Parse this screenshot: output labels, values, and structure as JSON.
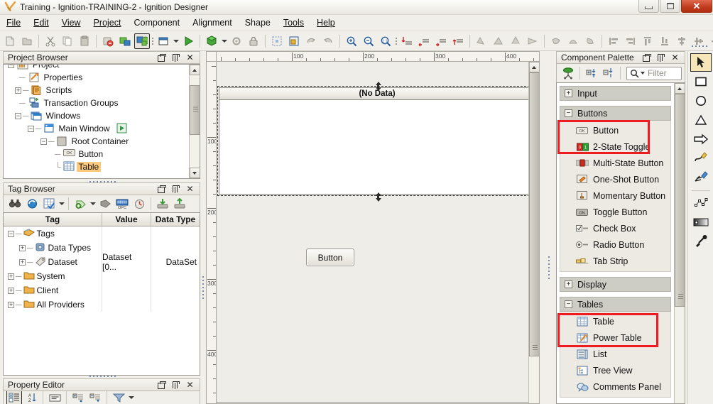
{
  "window": {
    "title": "Training - Ignition-TRAINING-2 - Ignition Designer",
    "app_icon": "ignition-logo-icon",
    "controls": {
      "minimize": "minimize-icon",
      "maximize": "maximize-icon",
      "close": "✕"
    }
  },
  "menubar": {
    "items": [
      {
        "label": "File",
        "mnemonic": "F"
      },
      {
        "label": "Edit",
        "mnemonic": "E"
      },
      {
        "label": "View",
        "mnemonic": "V"
      },
      {
        "label": "Project",
        "mnemonic": "P"
      },
      {
        "label": "Component",
        "mnemonic": "C"
      },
      {
        "label": "Alignment",
        "mnemonic": "A"
      },
      {
        "label": "Shape",
        "mnemonic": "S"
      },
      {
        "label": "Tools",
        "mnemonic": "T"
      },
      {
        "label": "Help",
        "mnemonic": "H"
      }
    ]
  },
  "toolbar": {
    "groups": [
      {
        "buttons": [
          {
            "name": "new-icon",
            "disabled": true
          },
          {
            "name": "open-icon",
            "disabled": true
          }
        ]
      },
      {
        "buttons": [
          {
            "name": "cut-icon",
            "disabled": true
          },
          {
            "name": "copy-icon",
            "disabled": true
          },
          {
            "name": "paste-icon",
            "disabled": true
          }
        ]
      },
      {
        "buttons": [
          {
            "name": "save-disabled-icon",
            "disabled": true
          },
          {
            "name": "publish-icon",
            "disabled": false
          },
          {
            "name": "update-project-icon",
            "selected": true
          }
        ]
      },
      {
        "buttons": [
          {
            "name": "new-window-icon",
            "disabled": false
          },
          {
            "name": "window-dropdown-arrow",
            "type": "arrow"
          },
          {
            "name": "preview-mode-icon",
            "disabled": false
          }
        ]
      },
      {
        "buttons": [
          {
            "name": "new-template-icon",
            "disabled": false
          },
          {
            "name": "template-dropdown-arrow",
            "type": "arrow"
          },
          {
            "name": "settings-icon",
            "disabled": true
          },
          {
            "name": "lock-icon",
            "disabled": true
          }
        ]
      },
      {
        "buttons": [
          {
            "name": "select-all-icon",
            "disabled": true
          },
          {
            "name": "group-selection-icon",
            "disabled": false
          },
          {
            "name": "rotate-cw-icon",
            "disabled": true
          },
          {
            "name": "rotate-ccw-icon",
            "disabled": true
          }
        ]
      },
      {
        "buttons": [
          {
            "name": "zoom-in-icon",
            "disabled": false
          },
          {
            "name": "zoom-out-icon",
            "disabled": false
          },
          {
            "name": "zoom-reset-icon",
            "disabled": false
          }
        ]
      },
      {
        "buttons": [
          {
            "name": "bring-to-front-icon",
            "disabled": false
          },
          {
            "name": "send-backward-icon",
            "disabled": false
          },
          {
            "name": "bring-forward-icon",
            "disabled": false
          },
          {
            "name": "send-to-back-icon",
            "disabled": false
          }
        ]
      },
      {
        "buttons": [
          {
            "name": "shape-union-icon",
            "disabled": true
          },
          {
            "name": "shape-subtract-icon",
            "disabled": true
          },
          {
            "name": "shape-intersect-icon",
            "disabled": true
          },
          {
            "name": "shape-xor-icon",
            "disabled": true
          }
        ]
      },
      {
        "buttons": [
          {
            "name": "shape-combine-a-icon",
            "disabled": true
          },
          {
            "name": "shape-combine-b-icon",
            "disabled": true
          },
          {
            "name": "shape-combine-c-icon",
            "disabled": true
          }
        ]
      },
      {
        "buttons": [
          {
            "name": "align-left-icon",
            "disabled": true
          },
          {
            "name": "align-right-icon",
            "disabled": true
          },
          {
            "name": "align-top-icon",
            "disabled": true
          },
          {
            "name": "align-bottom-icon",
            "disabled": true
          },
          {
            "name": "align-center-h-icon",
            "disabled": true
          },
          {
            "name": "align-center-v-icon",
            "disabled": true
          },
          {
            "name": "distribute-h-icon",
            "disabled": true
          },
          {
            "name": "distribute-h-arrow",
            "type": "arrow"
          },
          {
            "name": "distribute-v-icon",
            "disabled": true
          },
          {
            "name": "distribute-v-arrow",
            "type": "arrow"
          },
          {
            "name": "same-width-icon",
            "disabled": false
          },
          {
            "name": "same-height-icon",
            "disabled": false
          }
        ]
      }
    ]
  },
  "project_browser": {
    "title": "Project Browser",
    "tree": [
      {
        "label": "Project",
        "icon": "project-icon",
        "depth": 0,
        "expander": "-",
        "partial": true
      },
      {
        "label": "Properties",
        "icon": "properties-icon",
        "depth": 1,
        "expander": ""
      },
      {
        "label": "Scripts",
        "icon": "scripts-icon",
        "depth": 1,
        "expander": "+"
      },
      {
        "label": "Transaction Groups",
        "icon": "transaction-groups-icon",
        "depth": 1,
        "expander": ""
      },
      {
        "label": "Windows",
        "icon": "windows-folder-icon",
        "depth": 1,
        "expander": "-"
      },
      {
        "label": "Main Window",
        "icon": "window-icon",
        "depth": 2,
        "expander": "-",
        "badge": "open-window-icon"
      },
      {
        "label": "Root Container",
        "icon": "container-icon",
        "depth": 3,
        "expander": "-"
      },
      {
        "label": "Button",
        "icon": "button-component-icon",
        "depth": 4,
        "expander": ""
      },
      {
        "label": "Table",
        "icon": "table-component-icon",
        "depth": 4,
        "expander": "",
        "selected": true
      }
    ]
  },
  "tag_browser": {
    "title": "Tag Browser",
    "toolbar": [
      "binoculars-icon",
      "refresh-tags-icon",
      "tag-editor-icon",
      "tag-dropdown-arrow",
      "new-tag-icon",
      "new-tag-dropdown-arrow",
      "tag-type-icon",
      "opc-browser-icon",
      "realtime-icon",
      "import-tags-icon",
      "export-tags-icon"
    ],
    "columns": [
      "Tag",
      "Value",
      "Data Type"
    ],
    "rows": [
      {
        "tag": "Tags",
        "value": "",
        "datatype": "",
        "depth": 0,
        "expander": "-",
        "icon": "tags-root-icon",
        "selected": true,
        "style": "italic-bold"
      },
      {
        "tag": "Data Types",
        "value": "",
        "datatype": "",
        "depth": 1,
        "expander": "+",
        "icon": "data-types-icon"
      },
      {
        "tag": "Dataset",
        "value": "Dataset [0...",
        "datatype": "DataSet",
        "depth": 1,
        "expander": "+",
        "icon": "dataset-tag-icon"
      },
      {
        "tag": "System",
        "value": "",
        "datatype": "",
        "depth": 0,
        "expander": "+",
        "icon": "folder-icon"
      },
      {
        "tag": "Client",
        "value": "",
        "datatype": "",
        "depth": 0,
        "expander": "+",
        "icon": "folder-icon"
      },
      {
        "tag": "All Providers",
        "value": "",
        "datatype": "",
        "depth": 0,
        "expander": "+",
        "icon": "folder-icon"
      }
    ]
  },
  "property_editor": {
    "title": "Property Editor",
    "toolbar": [
      "property-categories-icon",
      "sort-az-icon",
      "description-icon",
      "expand-all-icon",
      "collapse-all-icon",
      "filter-icon",
      "filter-dropdown-arrow"
    ]
  },
  "designer": {
    "ruler_h_labels": [
      "100",
      "200",
      "300",
      "400"
    ],
    "ruler_v_labels": [
      "100",
      "200",
      "300",
      "400"
    ],
    "table_component": {
      "header_text": "(No Data)",
      "name": "table-component",
      "selected": true
    },
    "button_component": {
      "label": "Button",
      "name": "button-component"
    }
  },
  "component_palette": {
    "title": "Component Palette",
    "toolbar": [
      "palette-root-icon",
      "expand-all-groups-icon",
      "collapse-all-groups-icon"
    ],
    "filter": {
      "placeholder": "Filter",
      "value": "",
      "icon": "search-icon"
    },
    "groups": [
      {
        "label": "Input",
        "expander": "+",
        "expanded": false,
        "items": []
      },
      {
        "label": "Buttons",
        "expander": "-",
        "expanded": true,
        "highlighted": true,
        "items": [
          {
            "label": "Button",
            "icon": "button-ok-icon",
            "highlighted": true
          },
          {
            "label": "2-State Toggle",
            "icon": "two-state-toggle-icon"
          },
          {
            "label": "Multi-State Button",
            "icon": "multi-state-button-icon"
          },
          {
            "label": "One-Shot Button",
            "icon": "one-shot-button-icon"
          },
          {
            "label": "Momentary Button",
            "icon": "momentary-button-icon"
          },
          {
            "label": "Toggle Button",
            "icon": "toggle-button-icon"
          },
          {
            "label": "Check Box",
            "icon": "check-box-icon"
          },
          {
            "label": "Radio Button",
            "icon": "radio-button-icon"
          },
          {
            "label": "Tab Strip",
            "icon": "tab-strip-icon"
          }
        ]
      },
      {
        "label": "Display",
        "expander": "+",
        "expanded": false,
        "items": []
      },
      {
        "label": "Tables",
        "expander": "-",
        "expanded": true,
        "highlighted": true,
        "items": [
          {
            "label": "Table",
            "icon": "table-icon",
            "highlighted": true
          },
          {
            "label": "Power Table",
            "icon": "power-table-icon"
          },
          {
            "label": "List",
            "icon": "list-icon"
          },
          {
            "label": "Tree View",
            "icon": "tree-view-icon"
          },
          {
            "label": "Comments Panel",
            "icon": "comments-panel-icon"
          }
        ]
      }
    ],
    "highlight_color": "#ee1c20"
  },
  "draw_tools": {
    "items": [
      {
        "name": "selection-arrow-tool",
        "selected": true
      },
      {
        "name": "rectangle-tool"
      },
      {
        "name": "ellipse-tool"
      },
      {
        "name": "triangle-tool"
      },
      {
        "name": "arrow-shape-tool"
      },
      {
        "name": "pencil-tool"
      },
      {
        "name": "paintbrush-tool"
      },
      {
        "name": "polygon-path-tool"
      },
      {
        "name": "gradient-tool"
      },
      {
        "name": "eyedropper-tool"
      }
    ]
  }
}
